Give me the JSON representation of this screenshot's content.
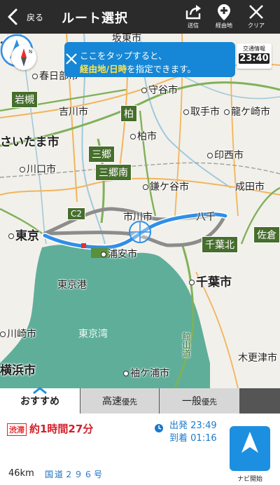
{
  "header": {
    "back_label": "戻る",
    "title": "ルート選択",
    "share_label": "送信",
    "waypoint_label": "経由地",
    "clear_label": "クリア"
  },
  "tip": {
    "line1": "ここをタップすると、",
    "highlight": "経由地/日時",
    "line2_rest": "を指定できます。"
  },
  "traffic": {
    "label": "交通情報",
    "time": "23:40"
  },
  "map": {
    "places": {
      "sakamoto": "坂東市",
      "kasukabe": "春日部市",
      "moriya": "守谷市",
      "yoshikawa": "吉川市",
      "toride": "取手市",
      "ryugasaki": "龍ケ崎市",
      "kashiwa": "柏市",
      "saitama": "さいたま市",
      "inzai": "印西市",
      "kawaguchi": "川口市",
      "kamagaya": "鎌ケ谷市",
      "narita": "成田市",
      "ichikawa": "市川市",
      "yachiyo": "八千",
      "tokyo": "東京",
      "urayasu": "浦安市",
      "chiba": "千葉市",
      "tokyo_port": "東京港",
      "tokyo_bay": "東京湾",
      "kawasaki": "川崎市",
      "yokohama": "横浜市",
      "sodegaura": "袖ケ浦市",
      "kisarazu": "木更津市",
      "left_cut": "市",
      "expressway": "館山道"
    },
    "labels": {
      "iwatsuki": "岩槻",
      "kashiwa_ic": "柏",
      "misato": "三郷",
      "misato_minami": "三郷南",
      "c2": "C2",
      "chiba_kita": "千葉北",
      "sakura": "佐倉"
    },
    "goal_letter": "G",
    "north_letter": "N"
  },
  "tabs": {
    "recommended": "おすすめ",
    "highway_main": "高速",
    "highway_sub": "優先",
    "general_main": "一般",
    "general_sub": "優先"
  },
  "route": {
    "jam_badge": "渋滞",
    "duration": "約1時間27分",
    "depart_label": "出発",
    "depart_time": "23:49",
    "arrive_label": "到着",
    "arrive_time": "01:16",
    "distance": "46km",
    "road": "国道２９６号"
  },
  "navi": {
    "label": "ナビ開始"
  },
  "colors": {
    "header_bg": "#2b2b2b",
    "route_blue": "#2f8fe6",
    "sea": "#5fae9a",
    "tip_blue": "#1687d6",
    "navi_blue": "#1d8fe0",
    "jam_red": "#d3202a",
    "green_label": "#466e2c"
  }
}
